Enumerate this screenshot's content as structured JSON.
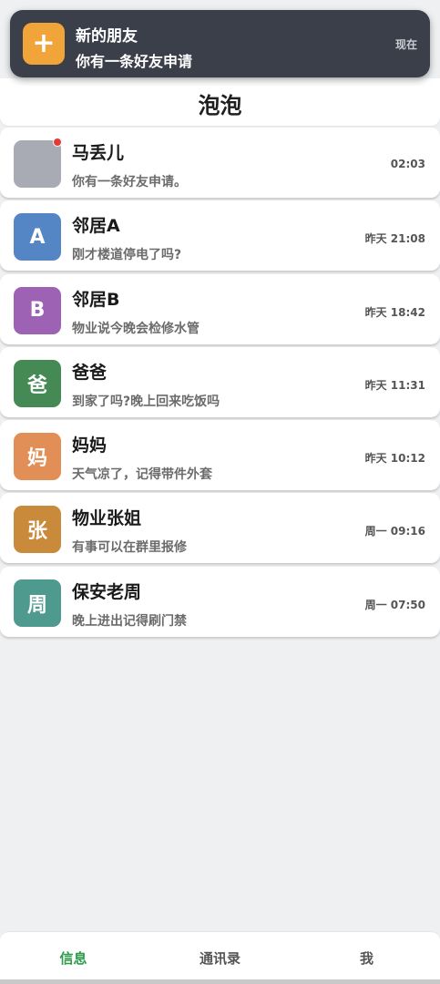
{
  "header": {
    "title": "泡泡"
  },
  "notification": {
    "icon": "plus-icon",
    "icon_color": "#f0a43a",
    "title": "新的朋友",
    "body": "你有一条好友申请",
    "time": "现在"
  },
  "chats": [
    {
      "name": "马丢儿",
      "message": "你有一条好友申请。",
      "time": "02:03",
      "avatar_text": "",
      "avatar_color": "#a8abb3",
      "unread": true
    },
    {
      "name": "邻居A",
      "message": "刚才楼道停电了吗?",
      "time": "昨天 21:08",
      "avatar_text": "A",
      "avatar_color": "#5485c5",
      "unread": false
    },
    {
      "name": "邻居B",
      "message": "物业说今晚会检修水管",
      "time": "昨天 18:42",
      "avatar_text": "B",
      "avatar_color": "#9d62b3",
      "unread": false
    },
    {
      "name": "爸爸",
      "message": "到家了吗?晚上回来吃饭吗",
      "time": "昨天 11:31",
      "avatar_text": "爸",
      "avatar_color": "#458a55",
      "unread": false
    },
    {
      "name": "妈妈",
      "message": "天气凉了，记得带件外套",
      "time": "昨天 10:12",
      "avatar_text": "妈",
      "avatar_color": "#e28e57",
      "unread": false
    },
    {
      "name": "物业张姐",
      "message": "有事可以在群里报修",
      "time": "周一 09:16",
      "avatar_text": "张",
      "avatar_color": "#c98a3c",
      "unread": false
    },
    {
      "name": "保安老周",
      "message": "晚上进出记得刷门禁",
      "time": "周一 07:50",
      "avatar_text": "周",
      "avatar_color": "#4e9a8f",
      "unread": false
    }
  ],
  "nav": {
    "tabs": [
      {
        "label": "信息",
        "active": true
      },
      {
        "label": "通讯录",
        "active": false
      },
      {
        "label": "我",
        "active": false
      }
    ],
    "active_color": "#2e9b4e"
  }
}
